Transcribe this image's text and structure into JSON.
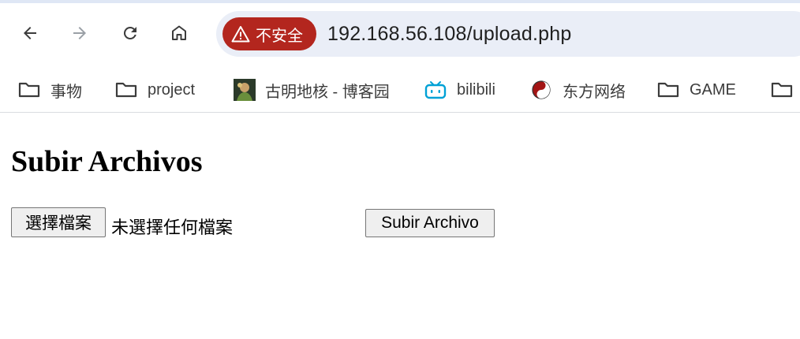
{
  "browser": {
    "nav": {
      "back_icon": "arrow-left-icon",
      "forward_icon": "arrow-right-icon",
      "reload_icon": "reload-icon",
      "home_icon": "home-icon"
    },
    "security_label": "不安全",
    "url": "192.168.56.108/upload.php",
    "colors": {
      "security_chip": "#b3261e",
      "omnibox": "#eaeef7"
    }
  },
  "bookmarks": [
    {
      "label": "事物",
      "icon": "folder-icon"
    },
    {
      "label": "project",
      "icon": "folder-icon"
    },
    {
      "label": "古明地核 - 博客园",
      "icon": "avatar-image"
    },
    {
      "label": "bilibili",
      "icon": "bilibili-icon"
    },
    {
      "label": "东方网络",
      "icon": "yinyang-icon"
    },
    {
      "label": "GAME",
      "icon": "folder-icon"
    },
    {
      "label": "",
      "icon": "folder-icon"
    }
  ],
  "page": {
    "title": "Subir Archivos",
    "file_button_label": "選擇檔案",
    "file_status": "未選擇任何檔案",
    "submit_label": "Subir Archivo"
  }
}
